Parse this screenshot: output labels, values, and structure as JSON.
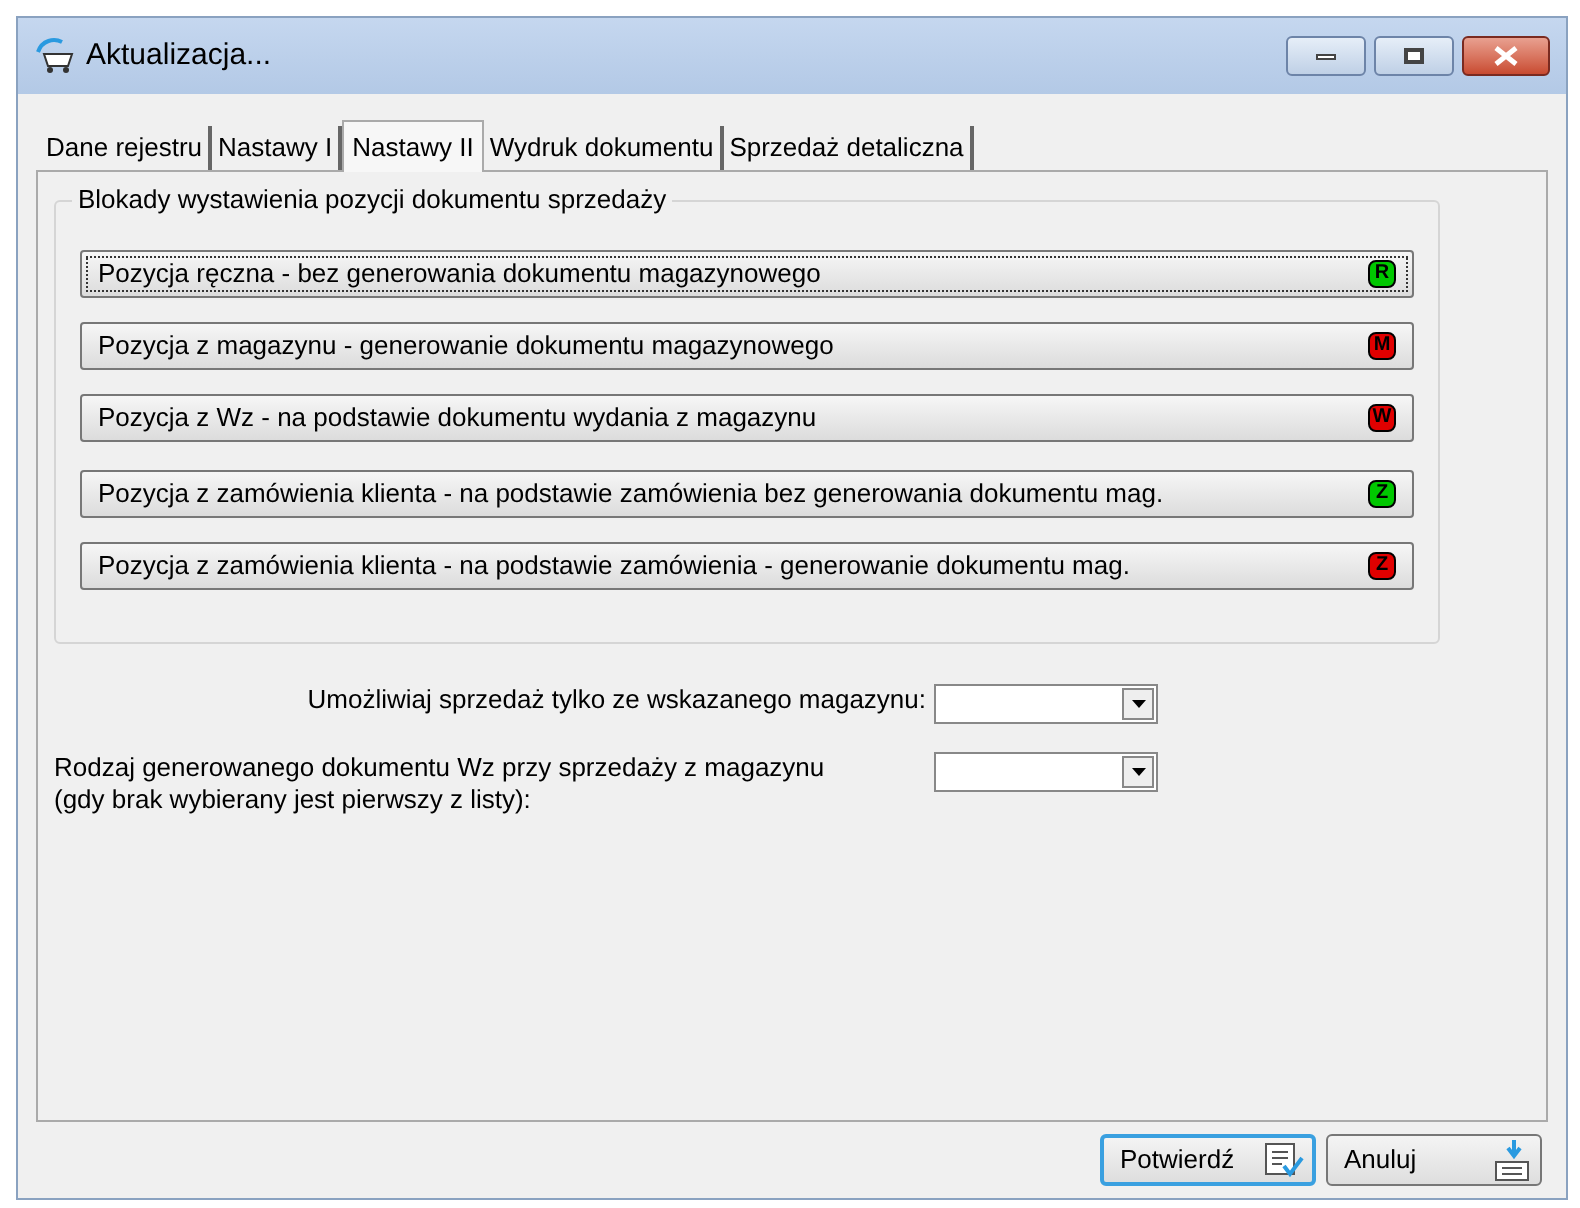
{
  "window": {
    "title": "Aktualizacja..."
  },
  "tabs": [
    {
      "label": "Dane rejestru",
      "selected": false
    },
    {
      "label": "Nastawy I",
      "selected": false
    },
    {
      "label": "Nastawy II",
      "selected": true
    },
    {
      "label": "Wydruk dokumentu",
      "selected": false
    },
    {
      "label": "Sprzedaż detaliczna",
      "selected": false
    }
  ],
  "group": {
    "title": "Blokady wystawienia pozycji dokumentu sprzedaży",
    "items": [
      {
        "label": "Pozycja ręczna - bez generowania dokumentu magazynowego",
        "badge": "R",
        "color": "#00c800",
        "focused": true
      },
      {
        "label": "Pozycja z magazynu - generowanie dokumentu magazynowego",
        "badge": "M",
        "color": "#e00000",
        "focused": false
      },
      {
        "label": "Pozycja z Wz - na podstawie dokumentu wydania z magazynu",
        "badge": "W",
        "color": "#e00000",
        "focused": false
      },
      {
        "label": "Pozycja z zamówienia klienta - na podstawie zamówienia bez generowania dokumentu mag.",
        "badge": "Z",
        "color": "#00c800",
        "focused": false
      },
      {
        "label": "Pozycja z zamówienia klienta - na podstawie zamówienia - generowanie dokumentu mag.",
        "badge": "Z",
        "color": "#e00000",
        "focused": false
      }
    ]
  },
  "fields": [
    {
      "label": "Umożliwiaj sprzedaż tylko ze wskazanego magazynu:"
    },
    {
      "label": "Rodzaj generowanego dokumentu Wz przy sprzedaży z magazynu",
      "note": "(gdy brak wybierany jest pierwszy z listy):"
    }
  ],
  "buttons": [
    {
      "label": "Potwierdź",
      "kind": "confirm"
    },
    {
      "label": "Anuluj",
      "kind": "cancel"
    }
  ]
}
